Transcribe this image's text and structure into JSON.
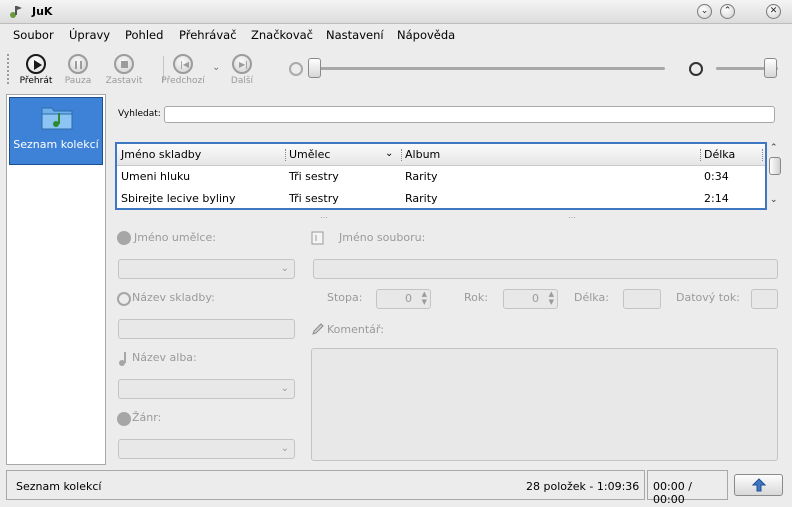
{
  "window": {
    "title": "JuK",
    "minimize_glyph": "⌄",
    "maximize_glyph": "⌃",
    "close_glyph": "✕"
  },
  "menu": [
    "Soubor",
    "Úpravy",
    "Pohled",
    "Přehrávač",
    "Značkovač",
    "Nastavení",
    "Nápověda"
  ],
  "toolbar": {
    "play": "Přehrát",
    "pause": "Pauza",
    "stop": "Zastavit",
    "previous": "Předchozí",
    "next": "Další"
  },
  "sidebar": {
    "collection_label": "Seznam kolekcí"
  },
  "search": {
    "label": "Vyhledat:",
    "value": ""
  },
  "playlist": {
    "columns": [
      "Jméno skladby",
      "Umělec",
      "Album",
      "Délka"
    ],
    "rows": [
      [
        "Umeni hluku",
        "Tři sestry",
        "Rarity",
        "0:34"
      ],
      [
        "Sbirejte lecive byliny",
        "Tři sestry",
        "Rarity",
        "2:14"
      ]
    ]
  },
  "editor": {
    "artist_label": "Jméno umělce:",
    "file_label": "Jméno souboru:",
    "track_title_label": "Název skladby:",
    "track_label": "Stopa:",
    "track_value": "0",
    "year_label": "Rok:",
    "year_value": "0",
    "length_label": "Délka:",
    "bitrate_label": "Datový tok:",
    "comment_label": "Komentář:",
    "album_label": "Název alba:",
    "genre_label": "Žánr:"
  },
  "status": {
    "left": "Seznam kolekcí",
    "count": "28 položek - 1:09:36",
    "time": "00:00 / 00:00"
  },
  "colors": {
    "selection": "#3e82d8",
    "accent_border": "#3e78c2"
  }
}
